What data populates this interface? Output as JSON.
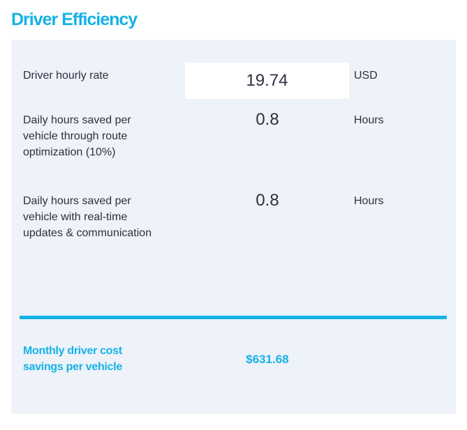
{
  "title": "Driver Efficiency",
  "rows": [
    {
      "label": "Driver hourly rate",
      "value": "19.74",
      "unit": "USD"
    },
    {
      "label": "Daily hours saved per vehicle through route optimization (10%)",
      "value": "0.8",
      "unit": "Hours"
    },
    {
      "label": "Daily hours saved per vehicle with real-time updates & communication",
      "value": "0.8",
      "unit": "Hours"
    }
  ],
  "result": {
    "label": "Monthly driver cost savings per vehicle",
    "value": "$631.68"
  },
  "colors": {
    "accent": "#14b2e6",
    "panel_bg": "#eef2f9",
    "text": "#2b3140"
  }
}
